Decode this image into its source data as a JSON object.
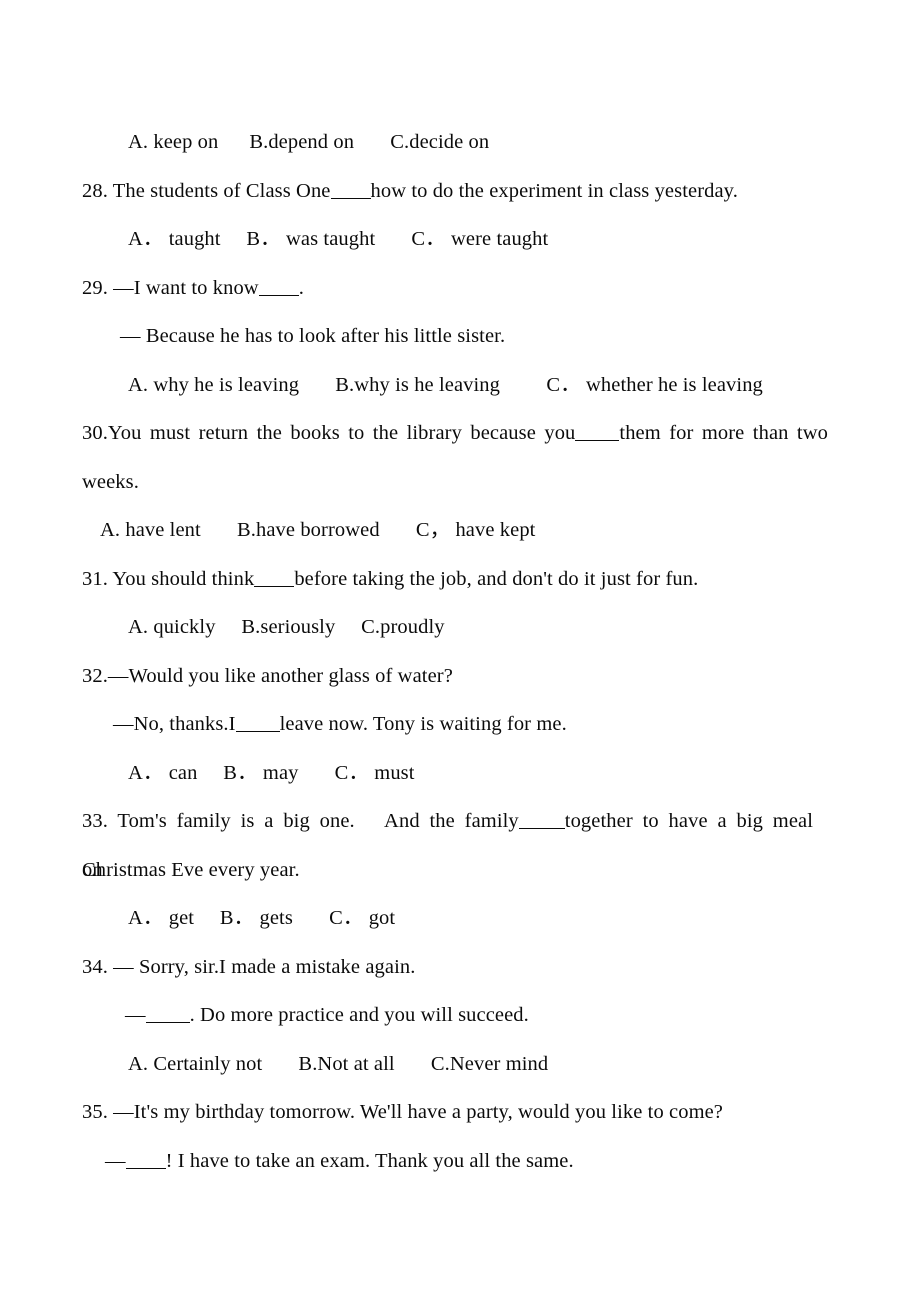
{
  "document": {
    "type": "english-grammar-multiple-choice-worksheet",
    "ink_color": "#0b0b0b",
    "page_color": "#ffffff"
  },
  "lines": {
    "q27_options": "A. keep on  B.depend on   C.decide on",
    "q28_stem_a": "28. The students of Class One",
    "q28_stem_b": "how to do the experiment in class yesterday.",
    "q28_options": "A． taught  B． was taught   C． were taught",
    "q29_stem_a": "29. —I want to know",
    "q29_stem_b": ".",
    "q29_answer": "— Because he has to look after his little sister.",
    "q29_options": "A. why he is leaving   B.why is he leaving   C． whether he is leaving",
    "q30_stem_a": "30.You must return the books to the library because you",
    "q30_stem_b": "them for more than two",
    "q30_stem_cont": "weeks.",
    "q30_options": "A. have lent   B.have borrowed   C， have kept",
    "q31_stem_a": "31. You should think",
    "q31_stem_b": "before taking the job, and don't do it just for fun.",
    "q31_options": "A. quickly  B.seriously  C.proudly",
    "q32_stem": "32.—Would you like another glass of water?",
    "q32_reply_a": "—No, thanks.I",
    "q32_reply_b": "leave now. Tony is waiting for me.",
    "q32_options": "A． can  B． may   C． must",
    "q33_stem_a": "33. Tom's family is a big one.  And the family",
    "q33_stem_b": "together to have a big meal on",
    "q33_stem_cont": "Christmas Eve every year.",
    "q33_options": "A． get  B． gets   C． got",
    "q34_stem": "34. — Sorry, sir.I made a mistake again.",
    "q34_reply_a": "—",
    "q34_reply_b": ". Do more practice and you will succeed.",
    "q34_options": "A. Certainly not   B.Not at all   C.Never mind",
    "q35_stem": "35. —It's my birthday tomorrow. We'll have a party, would you like to come?",
    "q35_reply_a": "—",
    "q35_reply_b": "! I have to take an exam. Thank you all the same."
  }
}
